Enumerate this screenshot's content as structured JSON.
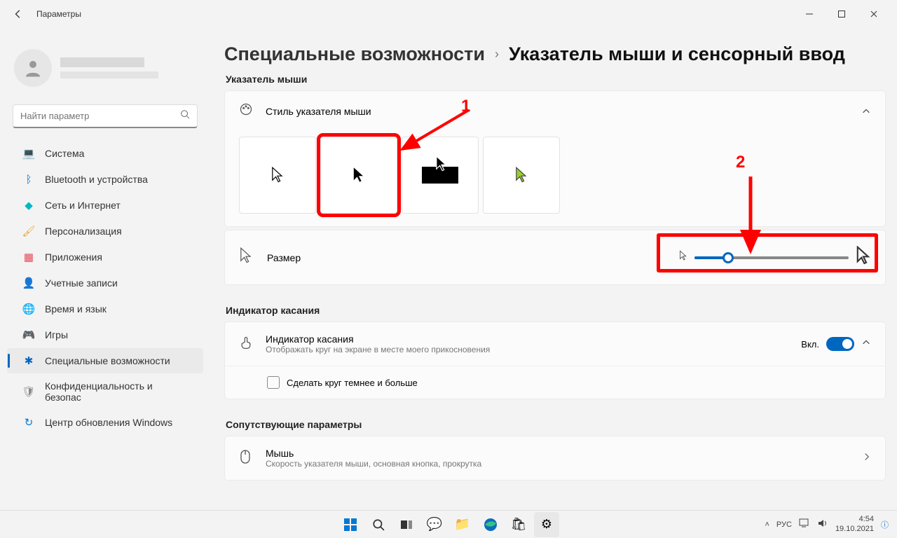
{
  "window": {
    "title": "Параметры"
  },
  "search": {
    "placeholder": "Найти параметр"
  },
  "nav": [
    {
      "label": "Система",
      "icon": "💻",
      "color": "#0078d4"
    },
    {
      "label": "Bluetooth и устройства",
      "icon": "ᛒ",
      "color": "#0078d4"
    },
    {
      "label": "Сеть и Интернет",
      "icon": "◆",
      "color": "#00b7c3"
    },
    {
      "label": "Персонализация",
      "icon": "🖌",
      "color": "#e8a33d"
    },
    {
      "label": "Приложения",
      "icon": "▦",
      "color": "#e74856"
    },
    {
      "label": "Учетные записи",
      "icon": "👤",
      "color": "#10893e"
    },
    {
      "label": "Время и язык",
      "icon": "🌐",
      "color": "#0078d4"
    },
    {
      "label": "Игры",
      "icon": "🎮",
      "color": "#888"
    },
    {
      "label": "Специальные возможности",
      "icon": "✱",
      "color": "#0067c0",
      "active": true
    },
    {
      "label": "Конфиденциальность и безопас",
      "icon": "🛡",
      "color": "#888"
    },
    {
      "label": "Центр обновления Windows",
      "icon": "↻",
      "color": "#0078d4"
    }
  ],
  "breadcrumb": {
    "parent": "Специальные возможности",
    "current": "Указатель мыши и сенсорный ввод"
  },
  "sections": {
    "pointer": "Указатель мыши",
    "touch": "Индикатор касания",
    "related": "Сопутствующие параметры"
  },
  "pointer_style": {
    "label": "Стиль указателя мыши"
  },
  "size": {
    "label": "Размер"
  },
  "touch_indicator": {
    "title": "Индикатор касания",
    "desc": "Отображать круг на экране в месте моего прикосновения",
    "state": "Вкл.",
    "option": "Сделать круг темнее и больше"
  },
  "mouse": {
    "title": "Мышь",
    "desc": "Скорость указателя мыши, основная кнопка, прокрутка"
  },
  "annotations": {
    "one": "1",
    "two": "2"
  },
  "tray": {
    "lang": "РУС",
    "time": "4:54",
    "date": "19.10.2021"
  }
}
